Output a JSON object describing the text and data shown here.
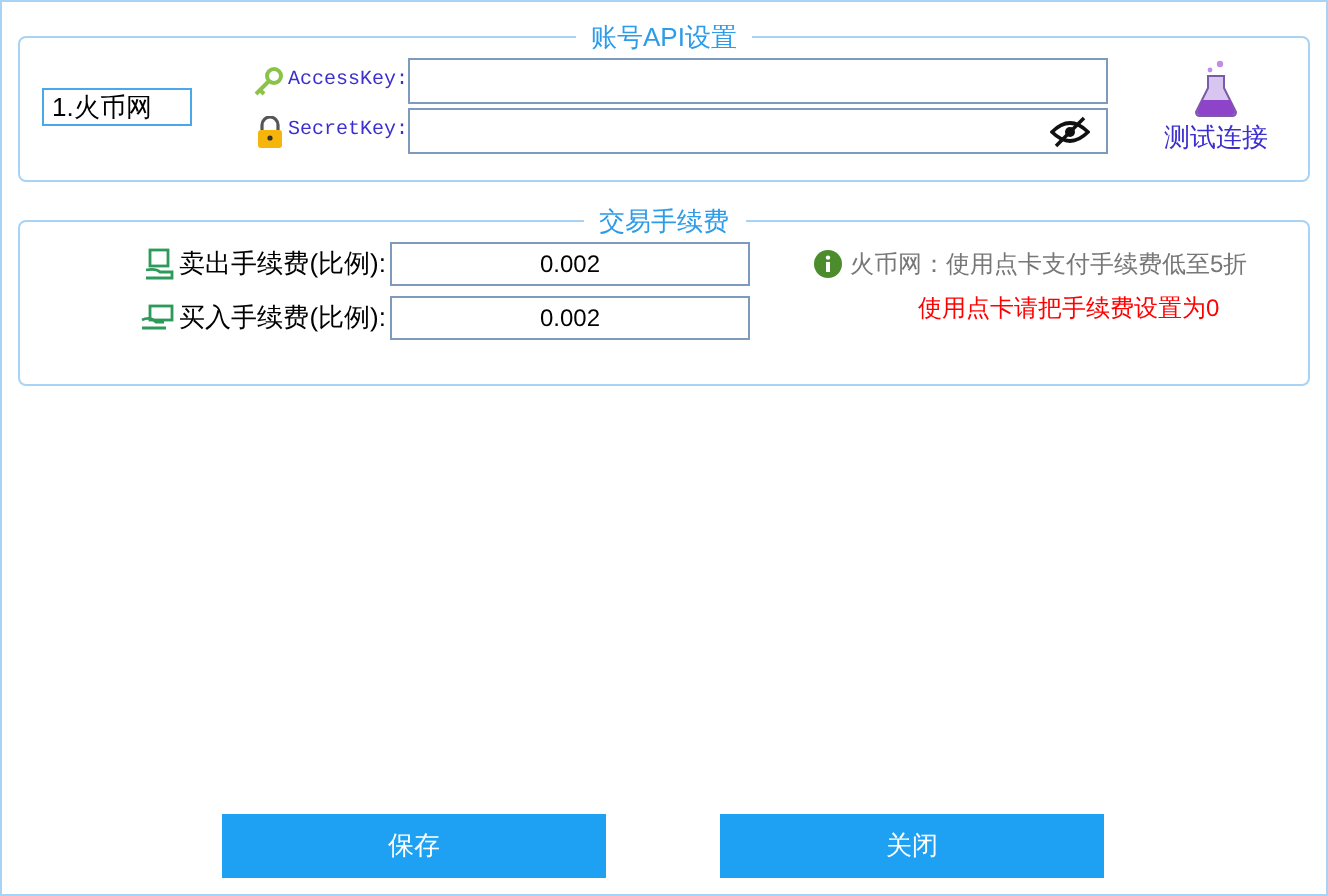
{
  "api_settings": {
    "title": "账号API设置",
    "exchange": {
      "value": "1.火币网"
    },
    "fields": [
      {
        "label": "AccessKey:",
        "kind": "text"
      },
      {
        "label": "SecretKey:",
        "kind": "secret"
      }
    ],
    "test_button": "测试连接"
  },
  "fees": {
    "title": "交易手续费",
    "rows": [
      {
        "label": "卖出手续费(比例):",
        "value": "0.002",
        "kind": "sell"
      },
      {
        "label": "买入手续费(比例):",
        "value": "0.002",
        "kind": "buy"
      }
    ],
    "info": "火币网：使用点卡支付手续费低至5折",
    "warning": "使用点卡请把手续费设置为0"
  },
  "buttons": [
    {
      "label": "保存"
    },
    {
      "label": "关闭"
    }
  ]
}
